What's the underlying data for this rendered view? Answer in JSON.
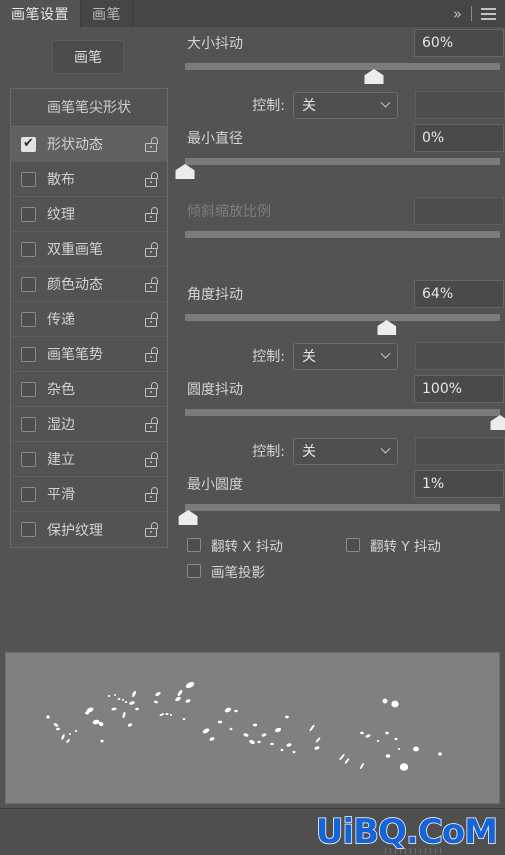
{
  "window": {
    "tabs": [
      {
        "label": "画笔设置",
        "active": true
      },
      {
        "label": "画笔",
        "active": false
      }
    ],
    "expand_icon": "»",
    "menu_icon": "hamburger-icon"
  },
  "sidebar": {
    "brush_button": "画笔",
    "header": "画笔笔尖形状",
    "items": [
      {
        "label": "形状动态",
        "checked": true,
        "selected": true
      },
      {
        "label": "散布",
        "checked": false,
        "selected": false
      },
      {
        "label": "纹理",
        "checked": false,
        "selected": false
      },
      {
        "label": "双重画笔",
        "checked": false,
        "selected": false
      },
      {
        "label": "颜色动态",
        "checked": false,
        "selected": false
      },
      {
        "label": "传递",
        "checked": false,
        "selected": false
      },
      {
        "label": "画笔笔势",
        "checked": false,
        "selected": false
      },
      {
        "label": "杂色",
        "checked": false,
        "selected": false
      },
      {
        "label": "湿边",
        "checked": false,
        "selected": false
      },
      {
        "label": "建立",
        "checked": false,
        "selected": false
      },
      {
        "label": "平滑",
        "checked": false,
        "selected": false
      },
      {
        "label": "保护纹理",
        "checked": false,
        "selected": false
      }
    ]
  },
  "settings": {
    "control_label": "控制:",
    "control_value": "关",
    "size_jitter": {
      "label": "大小抖动",
      "value": "60%",
      "percent": 60
    },
    "minimum_diameter": {
      "label": "最小直径",
      "value": "0%",
      "percent": 0
    },
    "tilt_scale": {
      "label": "倾斜缩放比例",
      "value": "",
      "percent": 0,
      "disabled": true
    },
    "angle_jitter": {
      "label": "角度抖动",
      "value": "64%",
      "percent": 64
    },
    "roundness_jitter": {
      "label": "圆度抖动",
      "value": "100%",
      "percent": 100
    },
    "minimum_roundness": {
      "label": "最小圆度",
      "value": "1%",
      "percent": 1
    },
    "flip_x": {
      "label": "翻转 X 抖动",
      "checked": false
    },
    "flip_y": {
      "label": "翻转 Y 抖动",
      "checked": false
    },
    "brush_projection": {
      "label": "画笔投影",
      "checked": false
    }
  },
  "preview": {
    "name": "brush-stroke-preview"
  },
  "watermark": {
    "text": "UiBQ.CoM"
  },
  "colors": {
    "panel_bg": "#535353",
    "tabbar_bg": "#454545",
    "track": "#7b7b7b",
    "thumb": "#ececec",
    "preview_bg": "#808080",
    "watermark_blue": "#1565d8"
  }
}
